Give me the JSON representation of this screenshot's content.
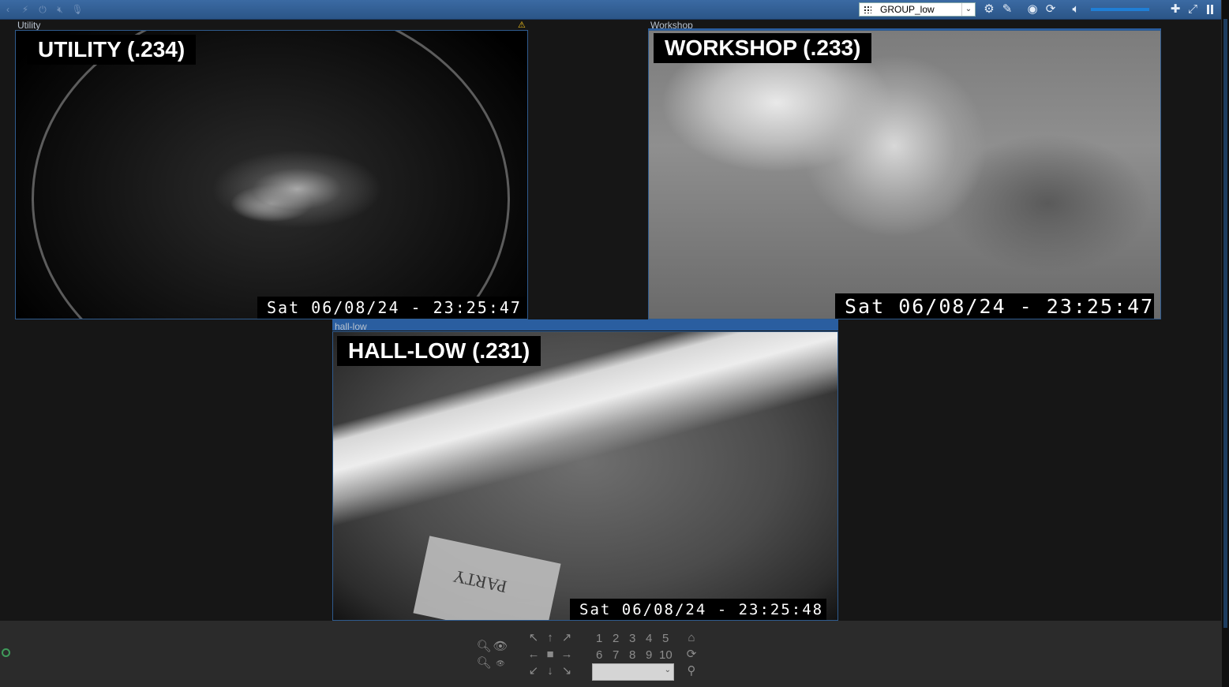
{
  "toolbar": {
    "left_icons": [
      "expand-icon",
      "lightning-icon",
      "power-icon",
      "mute-icon",
      "microphone-icon"
    ],
    "group_select": {
      "value": "GROUP_low"
    },
    "right_icons": [
      "settings-icon",
      "edit-icon",
      "record-icon",
      "refresh-icon",
      "speaker-icon",
      "add-icon",
      "fullscreen-icon",
      "pause-icon"
    ],
    "volume_level": 0.9,
    "accent": "#2b5587"
  },
  "cameras": [
    {
      "title": "Utility",
      "overlay": "UTILITY (.234)",
      "timestamp": "Sat 06/08/24 - 23:25:47",
      "alert": "⚠"
    },
    {
      "title": "Workshop",
      "overlay": "WORKSHOP (.233)",
      "timestamp": "Sat 06/08/24 - 23:25:47"
    },
    {
      "title": "hall-low",
      "overlay": "HALL-LOW (.231)",
      "timestamp": "Sat 06/08/24 - 23:25:48",
      "sign_text": "PARTY"
    }
  ],
  "ptz": {
    "zoom_icons": [
      "zoom-in-icon",
      "zoom-out-icon",
      "eye-icon",
      "eye-small-icon"
    ],
    "arrows": [
      "↖",
      "↑",
      "↗",
      "←",
      "■",
      "→",
      "↙",
      "↓",
      "↘"
    ],
    "presets_row1": [
      "1",
      "2",
      "3",
      "4",
      "5"
    ],
    "presets_row2": [
      "6",
      "7",
      "8",
      "9",
      "10"
    ],
    "preset_select": {
      "value": ""
    }
  }
}
